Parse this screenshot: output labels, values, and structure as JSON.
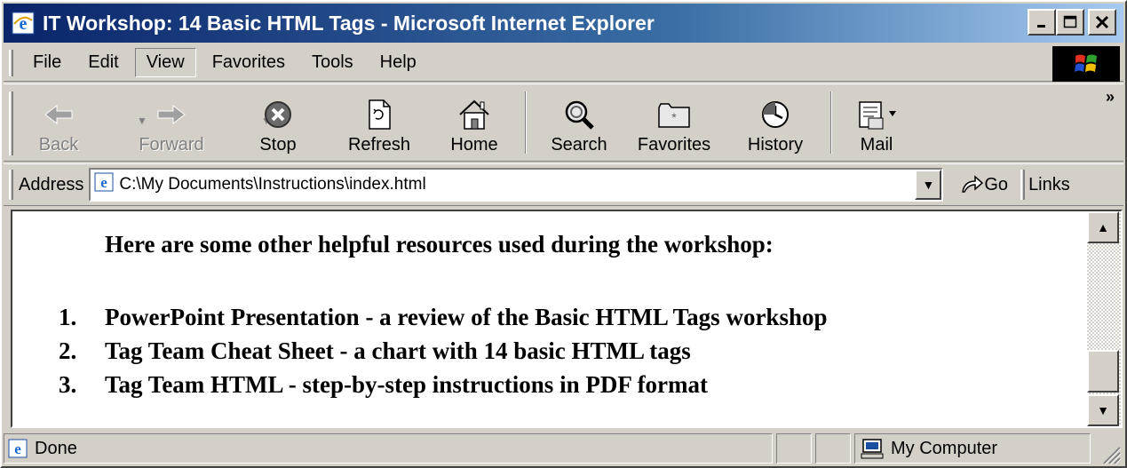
{
  "window": {
    "title": "IT Workshop: 14 Basic HTML Tags - Microsoft Internet Explorer",
    "minimize": "_",
    "maximize": "□",
    "close": "✕"
  },
  "menu": {
    "items": [
      "File",
      "Edit",
      "View",
      "Favorites",
      "Tools",
      "Help"
    ],
    "active": "View"
  },
  "toolbar": {
    "back": "Back",
    "forward": "Forward",
    "stop": "Stop",
    "refresh": "Refresh",
    "home": "Home",
    "search": "Search",
    "favorites": "Favorites",
    "history": "History",
    "mail": "Mail",
    "more": "»"
  },
  "address": {
    "label": "Address",
    "url": "C:\\My Documents\\Instructions\\index.html",
    "go": "Go",
    "links": "Links"
  },
  "content": {
    "intro": "Here are some other helpful resources used during the workshop:",
    "resources": [
      {
        "num": "1.",
        "text": "PowerPoint Presentation - a review of the Basic HTML Tags workshop"
      },
      {
        "num": "2.",
        "text": "Tag Team Cheat Sheet - a chart with 14 basic HTML tags"
      },
      {
        "num": "3.",
        "text": "Tag Team HTML - step-by-step instructions in PDF format"
      }
    ]
  },
  "status": {
    "text": "Done",
    "zone": "My Computer"
  },
  "icons": {
    "ie": "ie-logo-icon",
    "back": "back-arrow-icon",
    "forward": "forward-arrow-icon",
    "stop": "stop-icon",
    "refresh": "refresh-icon",
    "home": "home-icon",
    "search": "search-icon",
    "favorites": "favorites-folder-icon",
    "history": "history-icon",
    "mail": "mail-icon",
    "computer": "computer-icon"
  },
  "colors": {
    "title_start": "#0a246a",
    "title_end": "#a6caf0",
    "chrome": "#d4d0c8"
  }
}
